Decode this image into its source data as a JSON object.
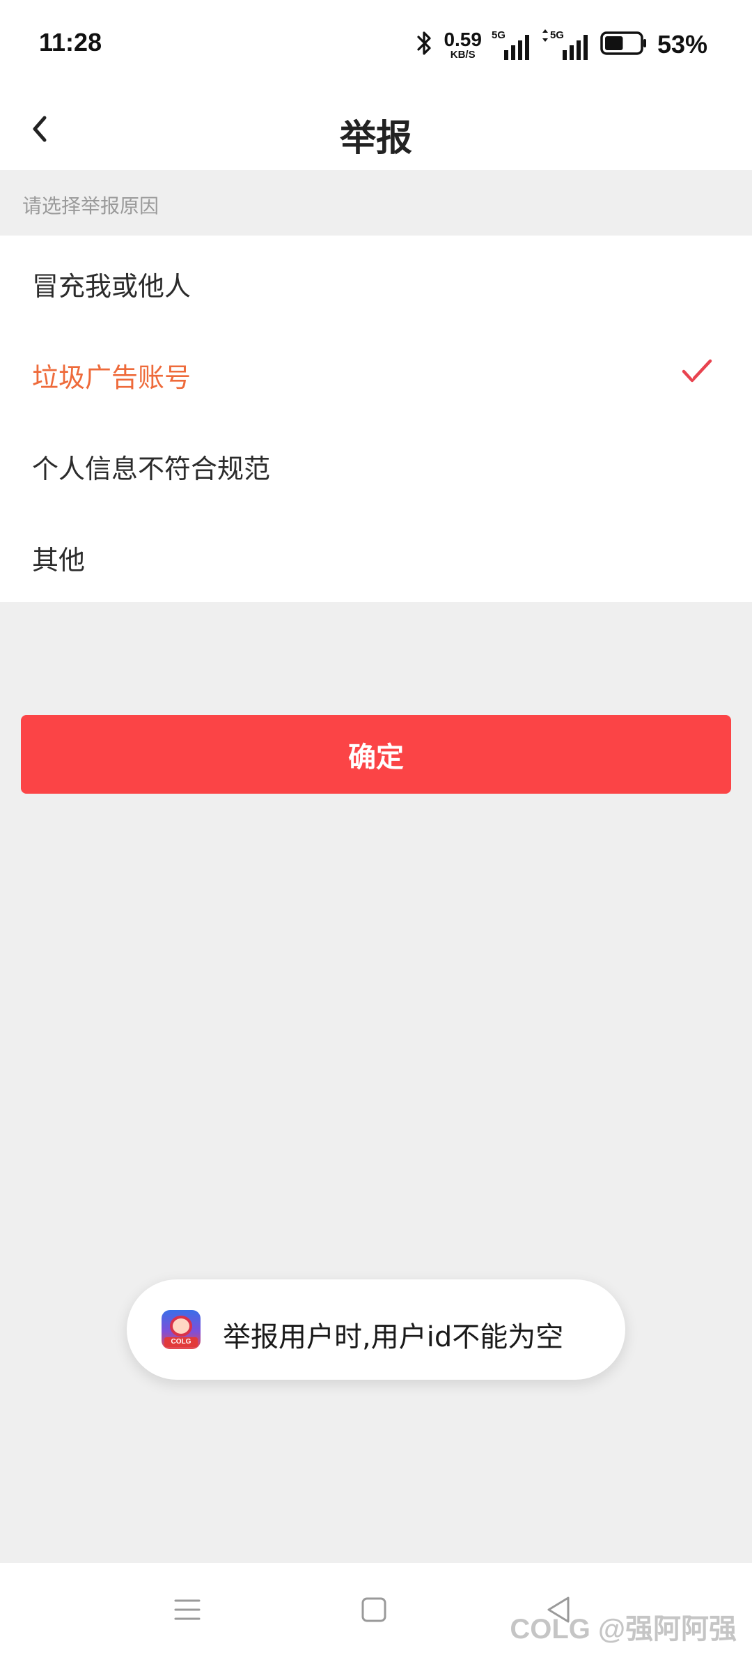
{
  "status_bar": {
    "time": "11:28",
    "net_speed_value": "0.59",
    "net_speed_unit": "KB/S",
    "signal1_tag": "5G",
    "signal2_tag": "5G",
    "battery_percent": "53%",
    "battery_level": 0.53
  },
  "nav": {
    "title": "举报"
  },
  "section": {
    "header": "请选择举报原因"
  },
  "options": [
    {
      "label": "冒充我或他人",
      "selected": false
    },
    {
      "label": "垃圾广告账号",
      "selected": true
    },
    {
      "label": "个人信息不符合规范",
      "selected": false
    },
    {
      "label": "其他",
      "selected": false
    }
  ],
  "confirm": {
    "label": "确定"
  },
  "toast": {
    "message": "举报用户时,用户id不能为空",
    "app_icon_text": "COLG"
  },
  "bottom_nav": {
    "watermark": "COLG @强阿阿强"
  },
  "colors": {
    "accent": "#fb4446",
    "selected_text": "#ee6a3a",
    "check": "#e8434f"
  }
}
